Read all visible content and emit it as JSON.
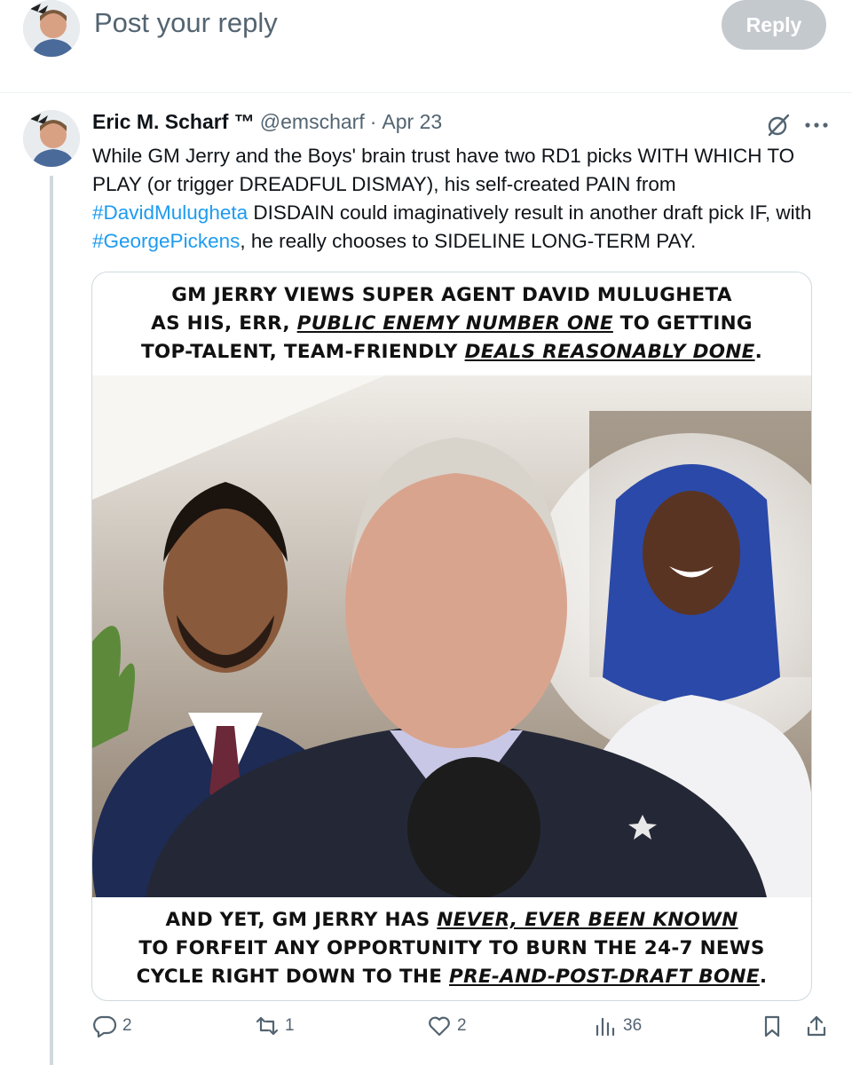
{
  "composer": {
    "placeholder": "Post your reply",
    "reply_label": "Reply"
  },
  "tweet": {
    "author_name": "Eric M. Scharf ™",
    "handle": "@emscharf",
    "separator": "·",
    "date": "Apr 23",
    "text_parts": [
      "While GM Jerry and the Boys' brain trust have two RD1 picks WITH WHICH TO PLAY (or trigger DREADFUL DISMAY), his self-created PAIN from ",
      "#DavidMulugheta",
      " DISDAIN could imaginatively result in another draft pick IF, with ",
      "#GeorgePickens",
      ", he really chooses to SIDELINE LONG-TERM PAY."
    ],
    "image": {
      "caption_top": {
        "line1": "GM JERRY VIEWS SUPER AGENT DAVID MULUGHETA",
        "line2_a": "AS HIS, ERR, ",
        "line2_b": "PUBLIC ENEMY NUMBER ONE",
        "line2_c": " TO GETTING",
        "line3_a": "TOP-TALENT, TEAM-FRIENDLY ",
        "line3_b": "DEALS REASONABLY DONE",
        "line3_c": "."
      },
      "caption_bottom": {
        "line1_a": "AND YET, GM JERRY HAS ",
        "line1_b": "NEVER, EVER BEEN KNOWN",
        "line2": "TO FORFEIT ANY OPPORTUNITY TO BURN THE 24-7 NEWS",
        "line3_a": "CYCLE RIGHT DOWN TO THE ",
        "line3_b": "PRE-AND-POST-DRAFT BONE",
        "line3_c": "."
      }
    },
    "actions": {
      "replies": "2",
      "reposts": "1",
      "likes": "2",
      "views": "36"
    }
  },
  "icons": [
    "grok-icon",
    "more-icon",
    "reply-icon",
    "repost-icon",
    "like-icon",
    "views-icon",
    "bookmark-icon",
    "share-icon"
  ],
  "colors": {
    "link": "#1d9bf0",
    "secondary": "#536471",
    "reply_button": "#c4c9ce"
  }
}
